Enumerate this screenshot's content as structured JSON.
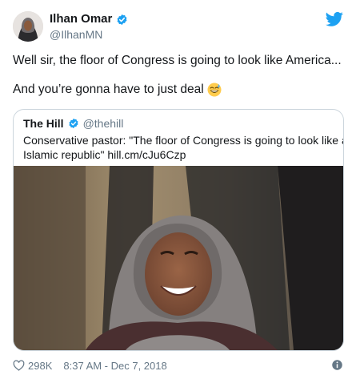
{
  "author": {
    "display_name": "Ilhan Omar",
    "handle": "@IlhanMN"
  },
  "tweet": {
    "line1": "Well sir, the floor of Congress is going to look like America...",
    "line2": "And you’re gonna have to just deal",
    "emoji": "grinning-squinting-face-with-sweat"
  },
  "quoted": {
    "display_name": "The Hill",
    "handle": "@thehill",
    "text_line1": "Conservative pastor: \"The floor of Congress is going to look like an",
    "text_line2": "Islamic republic\" hill.cm/cJu6Czp"
  },
  "footer": {
    "likes": "298K",
    "timestamp": "8:37 AM - Dec 7, 2018"
  },
  "colors": {
    "verified_blue": "#1da1f2",
    "secondary_text": "#657786",
    "border": "#ccd6dd"
  }
}
